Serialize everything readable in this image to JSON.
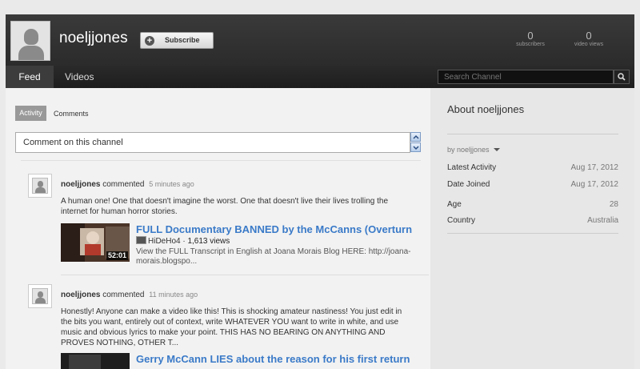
{
  "channel": {
    "name": "noeljjones",
    "subscribe_label": "Subscribe",
    "stats": [
      {
        "value": "0",
        "label": "subscribers"
      },
      {
        "value": "0",
        "label": "video views"
      }
    ]
  },
  "nav": {
    "tabs": [
      {
        "label": "Feed",
        "active": true
      },
      {
        "label": "Videos"
      }
    ],
    "search_placeholder": "Search Channel"
  },
  "feed": {
    "tabs": [
      {
        "label": "Activity",
        "active": true
      },
      {
        "label": "Comments"
      }
    ],
    "comment_placeholder": "Comment on this channel",
    "items": [
      {
        "author": "noeljjones",
        "verb": "commented",
        "time_ago": "5 minutes ago",
        "text": "A human one! One that doesn't imagine the worst. One that doesn't live their lives trolling the internet for human horror stories.",
        "video": {
          "title": "FULL Documentary BANNED by the McCanns (Overturne...",
          "uploader": "HiDeHo4",
          "views": "1,613 views",
          "duration": "52:01",
          "description": "View the FULL Transcript in English at Joana Morais Blog HERE: http://joana-morais.blogspo..."
        }
      },
      {
        "author": "noeljjones",
        "verb": "commented",
        "time_ago": "11 minutes ago",
        "text": "Honestly! Anyone can make a video like this! This is shocking amateur nastiness! You just edit in the bits you want, entirely out of context, write WHATEVER YOU want to write in white, and use music and obvious lyrics to make your point. THIS HAS NO BEARING ON ANYTHING AND PROVES NOTHING, OTHER T...",
        "video": {
          "title": "Gerry McCann LIES about the reason for his first return t..."
        }
      }
    ]
  },
  "about": {
    "title": "About noeljjones",
    "byline": "by noeljjones",
    "rows": [
      {
        "key": "Latest Activity",
        "value": "Aug 17, 2012"
      },
      {
        "key": "Date Joined",
        "value": "Aug 17, 2012"
      },
      {
        "key": "Age",
        "value": "28"
      },
      {
        "key": "Country",
        "value": "Australia"
      }
    ]
  },
  "colors": {
    "header_bg": "#2f2f2f",
    "link_blue": "#3a7ac8",
    "feed_bg": "#f2f2f2",
    "sidebar_bg": "#e7e7e7"
  }
}
